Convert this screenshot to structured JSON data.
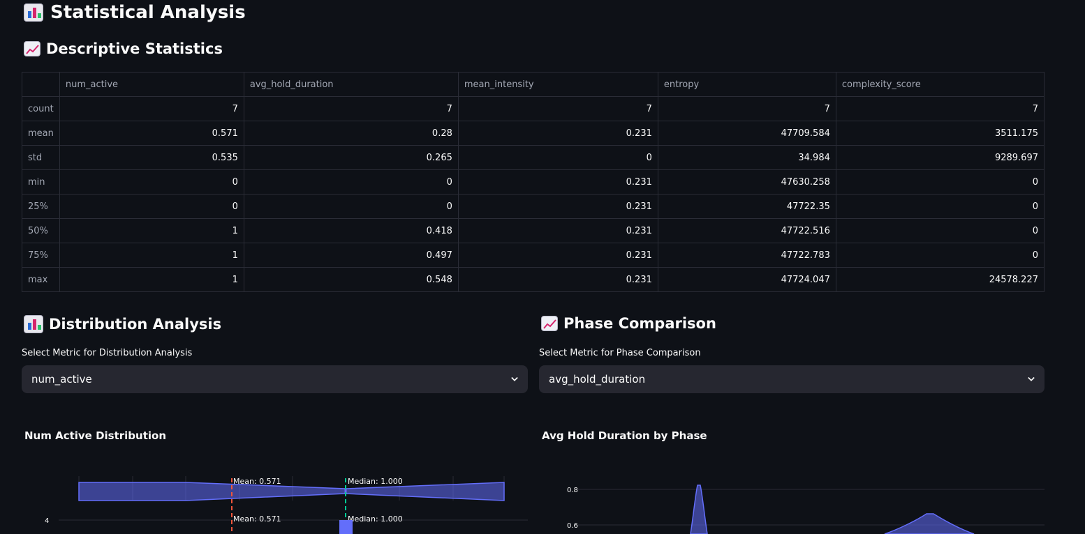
{
  "page_title": "Statistical Analysis",
  "descriptive": {
    "heading": "Descriptive Statistics",
    "columns": [
      "",
      "num_active",
      "avg_hold_duration",
      "mean_intensity",
      "entropy",
      "complexity_score"
    ],
    "rows": [
      {
        "label": "count",
        "values": [
          "7",
          "7",
          "7",
          "7",
          "7"
        ]
      },
      {
        "label": "mean",
        "values": [
          "0.571",
          "0.28",
          "0.231",
          "47709.584",
          "3511.175"
        ]
      },
      {
        "label": "std",
        "values": [
          "0.535",
          "0.265",
          "0",
          "34.984",
          "9289.697"
        ]
      },
      {
        "label": "min",
        "values": [
          "0",
          "0",
          "0.231",
          "47630.258",
          "0"
        ]
      },
      {
        "label": "25%",
        "values": [
          "0",
          "0",
          "0.231",
          "47722.35",
          "0"
        ]
      },
      {
        "label": "50%",
        "values": [
          "1",
          "0.418",
          "0.231",
          "47722.516",
          "0"
        ]
      },
      {
        "label": "75%",
        "values": [
          "1",
          "0.497",
          "0.231",
          "47722.783",
          "0"
        ]
      },
      {
        "label": "max",
        "values": [
          "1",
          "0.548",
          "0.231",
          "47724.047",
          "24578.227"
        ]
      }
    ]
  },
  "distribution": {
    "heading": "Distribution Analysis",
    "select_label": "Select Metric for Distribution Analysis",
    "selected": "num_active",
    "chart_title": "Num Active Distribution",
    "mean_label": "Mean: 0.571",
    "median_label": "Median: 1.000",
    "y_tick": "4"
  },
  "phase": {
    "heading": "Phase Comparison",
    "select_label": "Select Metric for Phase Comparison",
    "selected": "avg_hold_duration",
    "chart_title": "Avg Hold Duration by Phase",
    "y_ticks": [
      "0.8",
      "0.6"
    ]
  },
  "chart_data": [
    {
      "type": "histogram",
      "title": "Num Active Distribution",
      "mean": 0.571,
      "median": 1.0,
      "annotations": [
        "Mean: 0.571",
        "Median: 1.000"
      ],
      "yticks": [
        4
      ]
    },
    {
      "type": "violin",
      "title": "Avg Hold Duration by Phase",
      "yticks": [
        0.8,
        0.6
      ]
    }
  ],
  "colors": {
    "background": "#0e1117",
    "select_bg": "#262730",
    "violin_fill": "#636efa",
    "mean_line": "#ef553b",
    "median_line": "#00cc96"
  }
}
